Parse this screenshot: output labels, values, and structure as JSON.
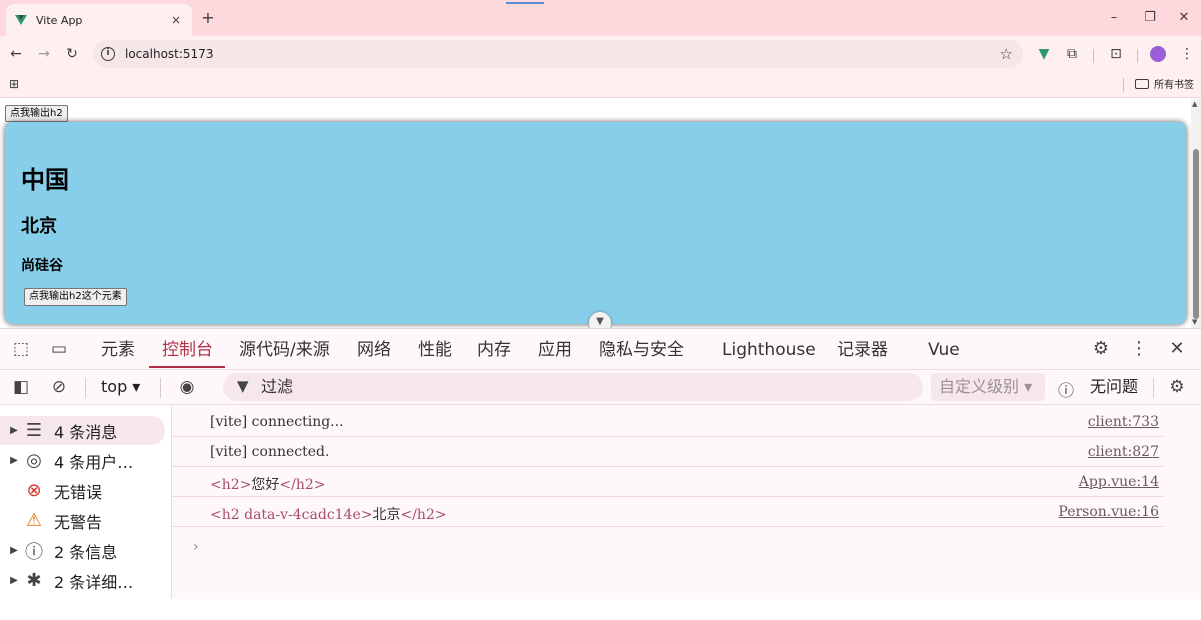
{
  "browser": {
    "tab_title": "Vite App",
    "tab_close": "×",
    "new_tab": "+",
    "url": "localhost:5173",
    "window_controls": {
      "minimize": "–",
      "maximize": "❐",
      "close": "✕"
    },
    "bookmarks_folder": "所有书签"
  },
  "page": {
    "output_button": "点我输出h2",
    "person": {
      "h1": "中国",
      "h2": "北京",
      "h3": "尚硅谷",
      "button": "点我输出h2这个元素",
      "background": "#87ceea"
    }
  },
  "devtools": {
    "tabs": [
      {
        "label": "元素"
      },
      {
        "label": "控制台",
        "active": true
      },
      {
        "label": "源代码/来源"
      },
      {
        "label": "网络"
      },
      {
        "label": "性能"
      },
      {
        "label": "内存"
      },
      {
        "label": "应用"
      },
      {
        "label": "隐私与安全"
      },
      {
        "label": "Lighthouse"
      },
      {
        "label": "记录器"
      },
      {
        "label": "Vue"
      }
    ],
    "filterbar": {
      "context": "top ▾",
      "filter_placeholder": "过滤",
      "levels": "自定义级别 ▾",
      "issues": "无问题"
    },
    "sidebar": [
      {
        "label": "4 条消息",
        "icon": "list-icon",
        "expandable": true
      },
      {
        "label": "4 条用户…",
        "icon": "user-icon",
        "expandable": true
      },
      {
        "label": "无错误",
        "icon": "error-icon",
        "expandable": false
      },
      {
        "label": "无警告",
        "icon": "warning-icon",
        "expandable": false
      },
      {
        "label": "2 条信息",
        "icon": "info-icon",
        "expandable": true
      },
      {
        "label": "2 条详细…",
        "icon": "bug-icon",
        "expandable": true
      }
    ],
    "console": [
      {
        "message": "[vite] connecting...",
        "source": "client:733"
      },
      {
        "message": "[vite] connected.",
        "source": "client:827"
      },
      {
        "open_tag": "<h2>",
        "text": "您好",
        "close_tag": "</h2>",
        "source": "App.vue:14"
      },
      {
        "open_tag": "<h2 data-v-4cadc14e>",
        "text": "北京",
        "close_tag": "</h2>",
        "source": "Person.vue:16"
      }
    ],
    "prompt": "›",
    "accent_color": "#b03048"
  }
}
